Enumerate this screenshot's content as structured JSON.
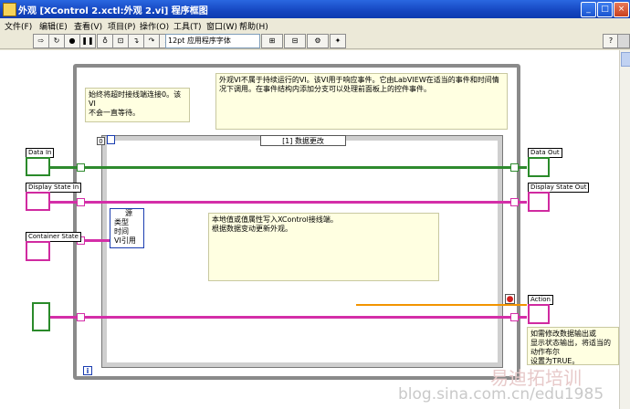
{
  "window": {
    "title": "外观 [XControl 2.xctl:外观 2.vi] 程序框图"
  },
  "menu": [
    "文件(F)",
    "编辑(E)",
    "查看(V)",
    "项目(P)",
    "操作(O)",
    "工具(T)",
    "窗口(W)",
    "帮助(H)"
  ],
  "toolbar": {
    "font": "12pt 应用程序字体",
    "help": "?"
  },
  "loop": {
    "iteration": "i",
    "stop_constant": "0"
  },
  "event": {
    "selector": "[1] 数据更改"
  },
  "comments": {
    "timeout": "始终将超时接线端连接0。该VI\n不会一直等待。",
    "facade": "外观VI不属于持续运行的VI。该VI用于响应事件。它由LabVIEW在适当的事件和时间情\n况下调用。在事件结构内添加分支可以处理前面板上的控件事件。",
    "update": "本地值或值属性写入XControl接线端。\n根据数据变动更新外观。",
    "action": "如需修改数据输出或\n显示状态输出，将适当的\n动作布尔\n设置为TRUE。"
  },
  "terminals": {
    "data_in": "Data In",
    "display_state_in": "Display State In",
    "container_state": "Container State",
    "data_out": "Data Out",
    "display_state_out": "Display State Out",
    "action": "Action"
  },
  "event_node": [
    "源",
    "类型",
    "时间",
    "VI引用"
  ],
  "watermark": {
    "url": "blog.sina.com.cn/edu1985",
    "brand": "易迪拓培训"
  }
}
